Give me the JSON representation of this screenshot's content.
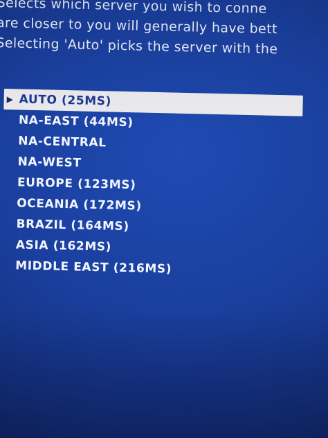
{
  "description": {
    "line1": "Selects which server you wish to conne",
    "line2": "are closer to you will generally have bett",
    "line3": "Selecting 'Auto' picks the server with the"
  },
  "servers": [
    {
      "label": "AUTO (25MS)",
      "selected": true
    },
    {
      "label": "NA-EAST (44MS)",
      "selected": false
    },
    {
      "label": "NA-CENTRAL",
      "selected": false
    },
    {
      "label": "NA-WEST",
      "selected": false
    },
    {
      "label": "EUROPE (123MS)",
      "selected": false
    },
    {
      "label": "OCEANIA (172MS)",
      "selected": false
    },
    {
      "label": "BRAZIL (164MS)",
      "selected": false
    },
    {
      "label": "ASIA (162MS)",
      "selected": false
    },
    {
      "label": "MIDDLE EAST (216MS)",
      "selected": false
    }
  ],
  "icons": {
    "selection_caret": "triangle-right-icon"
  },
  "colors": {
    "background": "#1a3f9e",
    "highlight": "#ececef",
    "selected_text": "#1f3a96",
    "text": "#f3f5ff"
  }
}
